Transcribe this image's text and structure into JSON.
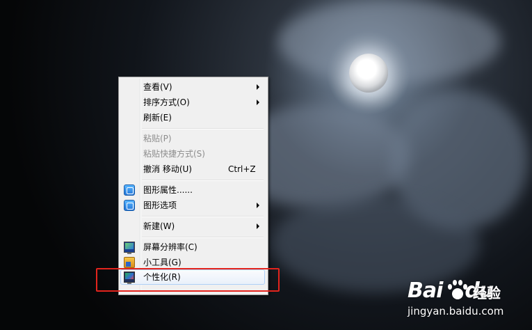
{
  "menu": {
    "items": [
      {
        "label": "查看(V)",
        "submenu": true
      },
      {
        "label": "排序方式(O)",
        "submenu": true
      },
      {
        "label": "刷新(E)"
      },
      {
        "label": "粘贴(P)",
        "disabled": true
      },
      {
        "label": "粘贴快捷方式(S)",
        "disabled": true
      },
      {
        "label": "撤消 移动(U)",
        "shortcut": "Ctrl+Z"
      },
      {
        "label": "图形属性......",
        "icon": "graphics-icon"
      },
      {
        "label": "图形选项",
        "icon": "graphics-icon",
        "submenu": true
      },
      {
        "label": "新建(W)",
        "submenu": true
      },
      {
        "label": "屏幕分辨率(C)",
        "icon": "monitor-icon"
      },
      {
        "label": "小工具(G)",
        "icon": "gadget-icon"
      },
      {
        "label": "个性化(R)",
        "icon": "personalize-icon",
        "highlighted": true
      }
    ]
  },
  "annotation": {
    "color": "#e3241d"
  },
  "watermark": {
    "logo_left": "Bai",
    "logo_right": "du",
    "name": "经验",
    "url": "jingyan.baidu.com"
  }
}
